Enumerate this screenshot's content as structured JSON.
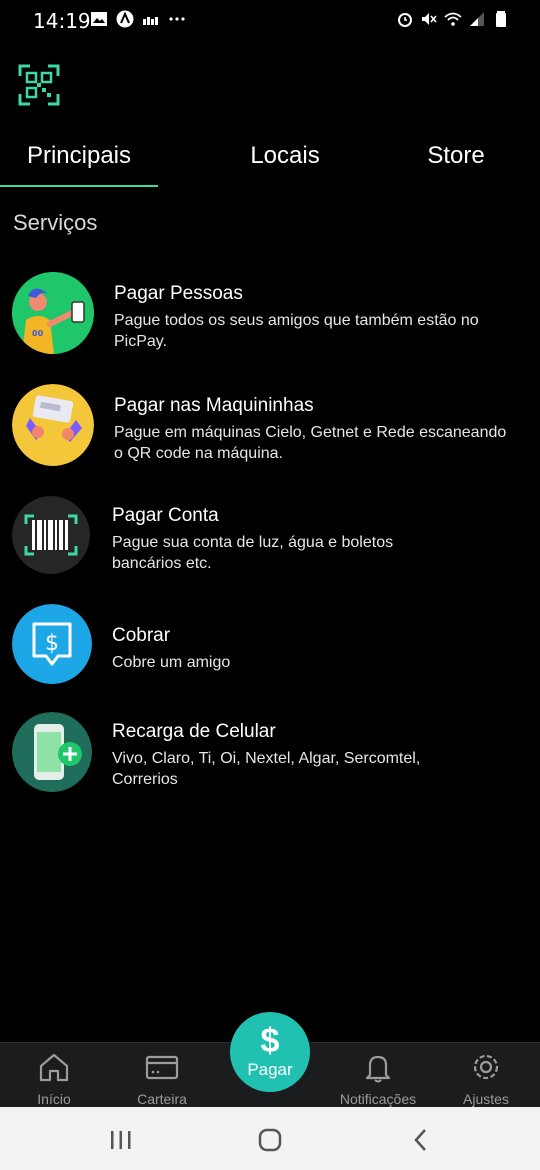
{
  "status_bar": {
    "time": "14:19",
    "left_icons": [
      "image-icon",
      "app-icon",
      "signal-bars-icon",
      "more-icon"
    ],
    "right_icons": [
      "alarm-icon",
      "mute-icon",
      "wifi-icon",
      "signal-icon",
      "battery-icon"
    ]
  },
  "header": {
    "qr_icon": "qr-code-icon"
  },
  "tabs": [
    {
      "label": "Principais",
      "active": true
    },
    {
      "label": "Locais",
      "active": false
    },
    {
      "label": "Store",
      "active": false
    }
  ],
  "accent_color": "#3fd7a6",
  "section_title": "Serviços",
  "services": [
    {
      "title": "Pagar Pessoas",
      "description": "Pague todos os seus amigos que também estão no PicPay.",
      "icon": "pay-people-icon",
      "icon_color": "#1fc76a"
    },
    {
      "title": "Pagar nas Maquininhas",
      "description": "Pague em máquinas Cielo, Getnet e Rede escaneando o QR code na máquina.",
      "icon": "card-machine-icon",
      "icon_color": "#f4c63a"
    },
    {
      "title": "Pagar Conta",
      "description": "Pague sua conta de luz, água e boletos bancários etc.",
      "icon": "barcode-icon",
      "icon_color": "#2a2a2a"
    },
    {
      "title": "Cobrar",
      "description": "Cobre um amigo",
      "icon": "charge-dollar-icon",
      "icon_color": "#1ea7e6"
    },
    {
      "title": "Recarga de Celular",
      "description": "Vivo, Claro, Ti, Oi, Nextel, Algar, Sercomtel, Correrios",
      "icon": "phone-recharge-icon",
      "icon_color": "#1f6d5a"
    }
  ],
  "bottom_nav": {
    "inicio": "Início",
    "carteira": "Carteira",
    "pagar": "Pagar",
    "pagar_symbol": "$",
    "notificacoes": "Notificações",
    "ajustes": "Ajustes",
    "pay_color": "#21c1b2"
  },
  "android_nav": [
    "recent-apps-icon",
    "home-icon",
    "back-icon"
  ]
}
